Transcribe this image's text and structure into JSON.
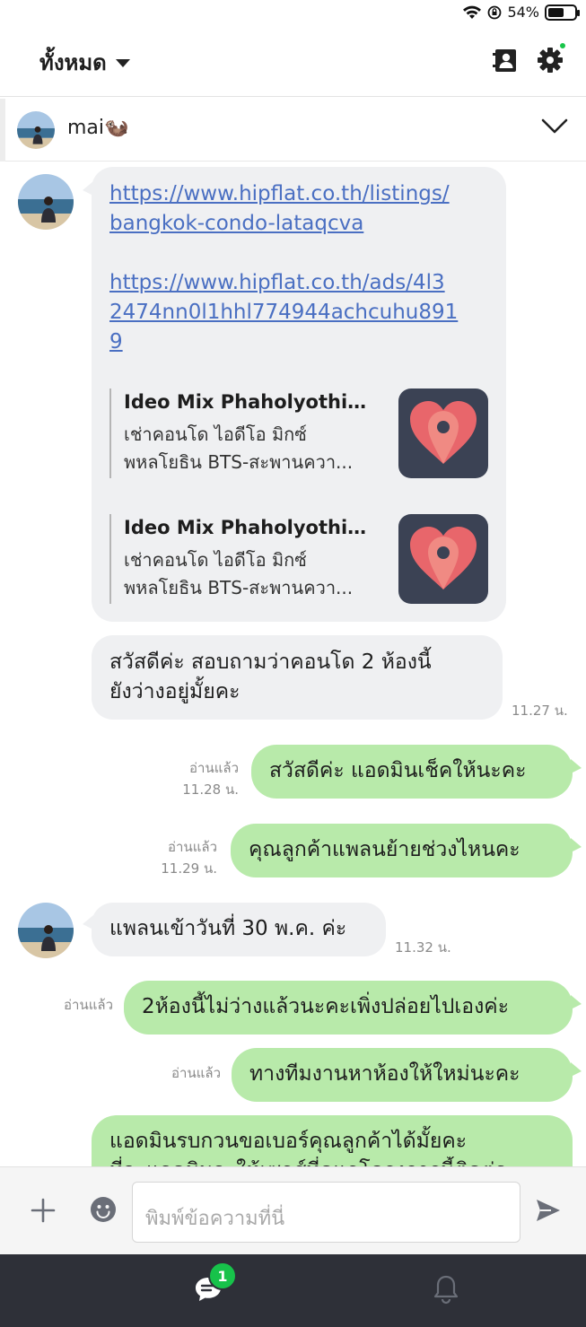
{
  "status_bar": {
    "battery": "54%",
    "battery_level": 0.54
  },
  "header": {
    "filter_label": "ทั้งหมด",
    "icons": [
      "contacts-icon",
      "settings-icon"
    ],
    "settings_has_notification": true
  },
  "contact": {
    "name": "mai🦦"
  },
  "messages": {
    "m1": {
      "link1_line1": "https://www.hipflat.co.th/listings/",
      "link1_line2": "bangkok-condo-lataqcva",
      "link2_line1": "https://www.hipflat.co.th/ads/4l3",
      "link2_line2": "2474nn0l1hhl774944achcuhu891",
      "link2_line3": "9",
      "preview1": {
        "title": "Ideo Mix Phaholyothin - ...",
        "desc1": "เช่าคอนโด ไอดีโอ มิกซ์",
        "desc2": "พหลโยธิน BTS-สะพานควา..."
      },
      "preview2": {
        "title": "Ideo Mix Phaholyothin - ...",
        "desc1": "เช่าคอนโด ไอดีโอ มิกซ์",
        "desc2": "พหลโยธิน BTS-สะพานควา..."
      }
    },
    "m2": {
      "line1": "สวัสดีค่ะ สอบถามว่าคอนโด 2 ห้องนี้",
      "line2": "ยังว่างอยู่มั้ยคะ",
      "time": "11.27 น."
    },
    "m3": {
      "text": "สวัสดีค่ะ แอดมินเช็คให้นะคะ",
      "read": "อ่านแล้ว",
      "time": "11.28 น."
    },
    "m4": {
      "text": "คุณลูกค้าแพลนย้ายช่วงไหนคะ",
      "read": "อ่านแล้ว",
      "time": "11.29 น."
    },
    "m5": {
      "text": "แพลนเข้าวันที่ 30 พ.ค. ค่ะ",
      "time": "11.32 น."
    },
    "m6": {
      "text": "2ห้องนี้ไม่ว่างแล้วนะคะเพิ่งปล่อยไปเองค่ะ",
      "read": "อ่านแล้ว"
    },
    "m7": {
      "text": "ทางทีมงานหาห้องให้ใหม่นะคะ",
      "read": "อ่านแล้ว"
    },
    "m8": {
      "line1": "แอดมินรบกวนขอเบอร์คุณลูกค้าได้มั้ยคะ",
      "line2": "ที่จะแอดมินจะให้เซลส์ที่ดูแลโครงการนี้ติดต่อ"
    }
  },
  "input": {
    "placeholder": "พิมพ์ข้อความที่นี่"
  },
  "bottom_nav": {
    "chat_badge": "1",
    "tabs": [
      "chat-icon",
      "bell-icon"
    ]
  },
  "colors": {
    "incoming": "#eff0f2",
    "outgoing": "#b8eaaa",
    "link": "#4a6fc2",
    "badge": "#17c24a",
    "nav": "#2e3038"
  }
}
